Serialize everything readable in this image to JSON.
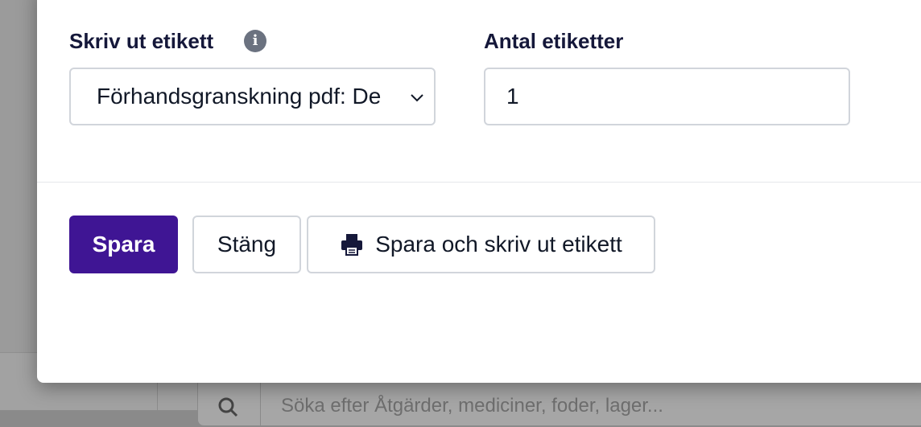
{
  "background": {
    "search_placeholder": "Söka efter Åtgärder, mediciner, foder, lager..."
  },
  "modal": {
    "print_label": {
      "label": "Skriv ut etikett",
      "selected_option": "Förhandsgranskning pdf: De"
    },
    "label_count": {
      "label": "Antal etiketter",
      "value": "1"
    },
    "buttons": {
      "save": "Spara",
      "close": "Stäng",
      "save_and_print": "Spara och skriv ut etikett"
    }
  },
  "colors": {
    "primary": "#3f1594",
    "label_text": "#15183a",
    "border": "#d1d5db",
    "info_icon": "#6b7280"
  },
  "icons": {
    "info": "info-icon",
    "chevron": "chevron-down-icon",
    "printer": "printer-icon",
    "search": "search-icon"
  }
}
